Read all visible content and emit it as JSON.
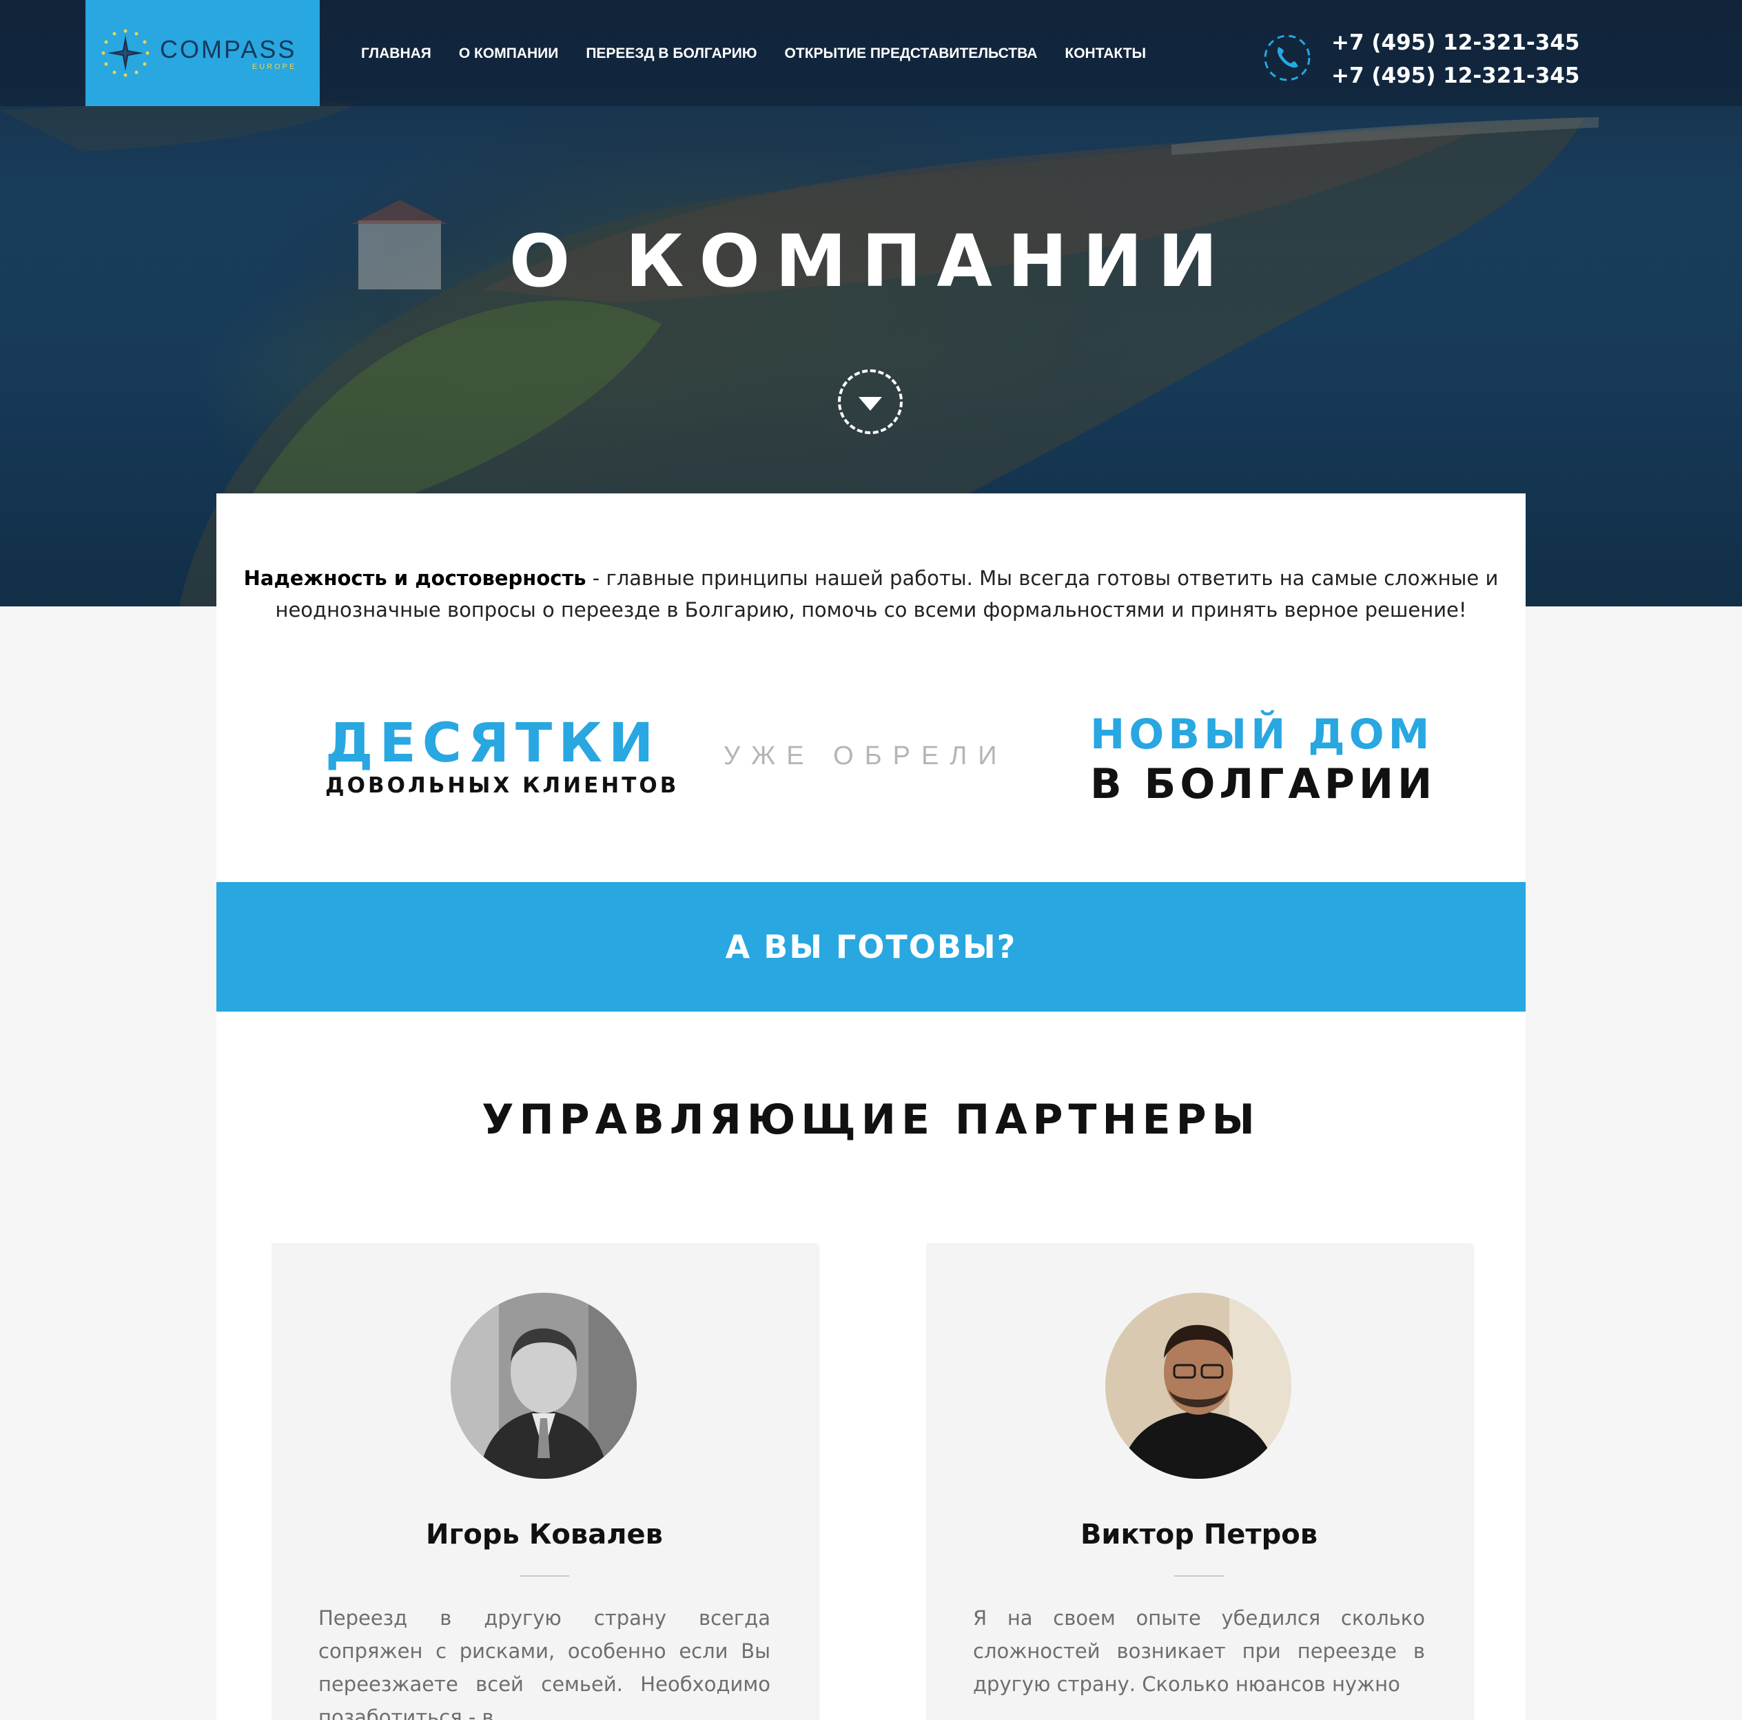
{
  "header": {
    "logo": {
      "name": "COMPASS",
      "sub": "EUROPE"
    },
    "nav": [
      {
        "label": "ГЛАВНАЯ"
      },
      {
        "label": "О КОМПАНИИ"
      },
      {
        "label": "ПЕРЕЕЗД В БОЛГАРИЮ"
      },
      {
        "label": "ОТКРЫТИЕ ПРЕДСТАВИТЕЛЬСТВА"
      },
      {
        "label": "КОНТАКТЫ"
      }
    ],
    "phones": [
      "+7 (495) 12-321-345",
      "+7 (495) 12-321-345"
    ]
  },
  "hero": {
    "title": "О КОМПАНИИ"
  },
  "intro": {
    "bold": "Надежность и достоверность",
    "text": " - главные принципы нашей работы. Мы всегда готовы ответить на самые сложные и неоднозначные вопросы о переезде в Болгарию, помочь со всеми формальностями и принять верное решение!"
  },
  "stats": {
    "left_big": "ДЕСЯТКИ",
    "left_small": "ДОВОЛЬНЫХ КЛИЕНТОВ",
    "middle": "УЖЕ ОБРЕЛИ",
    "right_line1": "НОВЫЙ ДОМ",
    "right_line2": "В БОЛГАРИИ"
  },
  "cta": {
    "label": "А ВЫ ГОТОВЫ?"
  },
  "partners": {
    "title": "УПРАВЛЯЮЩИЕ ПАРТНЕРЫ",
    "items": [
      {
        "name": "Игорь Ковалев",
        "quote": "Переезд в другую страну всегда сопряжен с рисками, особенно если Вы переезжаете всей семьей. Необходимо позаботиться - в"
      },
      {
        "name": "Виктор Петров",
        "quote": "Я на своем опыте убедился сколько сложностей возникает при переезде в другую страну. Сколько нюансов нужно"
      }
    ]
  },
  "colors": {
    "accent": "#28a7e1",
    "dark_text": "#111111",
    "muted_text": "#6e6e6e"
  },
  "icons": {
    "logo": "compass-star-icon",
    "phone": "phone-icon",
    "scroll": "chevron-down-icon"
  }
}
